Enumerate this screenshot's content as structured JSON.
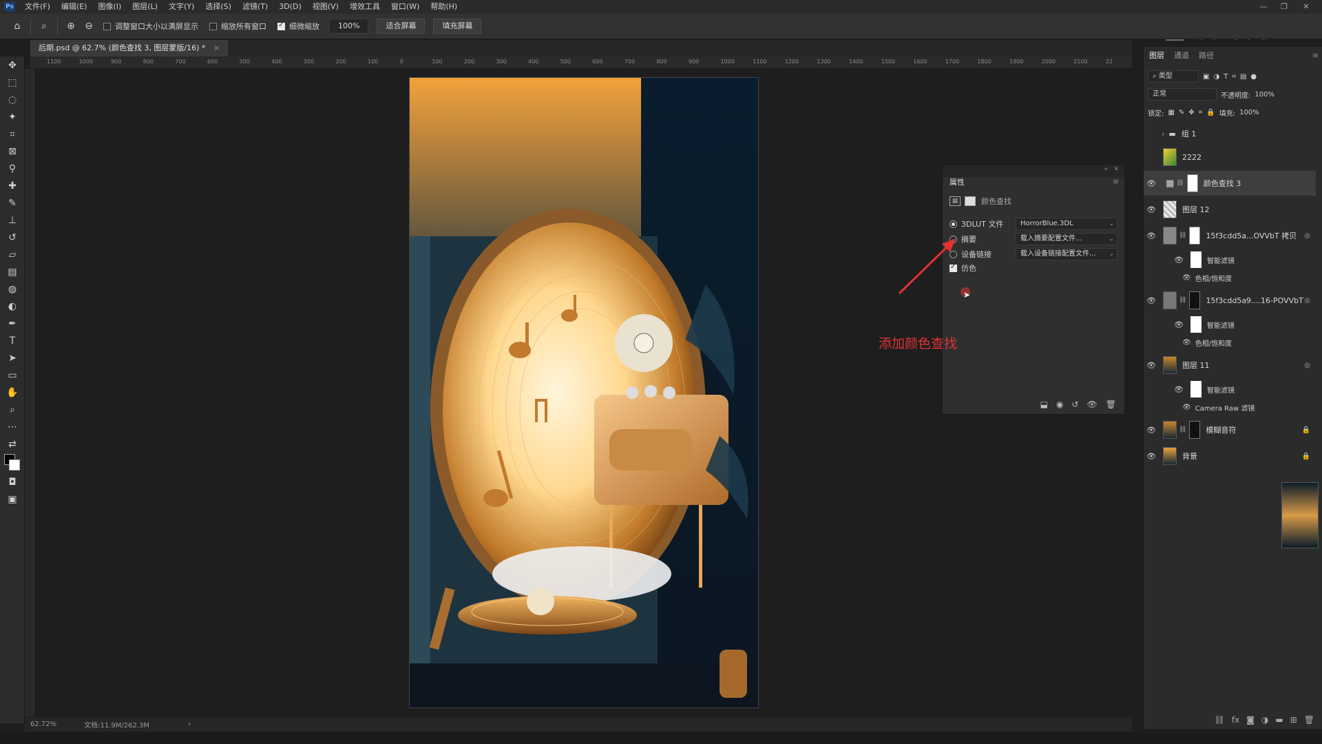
{
  "menubar": {
    "items": [
      "文件(F)",
      "编辑(E)",
      "图像(I)",
      "图层(L)",
      "文字(Y)",
      "选择(S)",
      "滤镜(T)",
      "3D(D)",
      "视图(V)",
      "增效工具",
      "窗口(W)",
      "帮助(H)"
    ],
    "logo": "Ps"
  },
  "options": {
    "resize_windows": "调整窗口大小以满屏显示",
    "zoom_all": "缩放所有窗口",
    "scrubby_zoom": "细微缩放",
    "zoom_value": "100%",
    "fit_screen": "适合屏幕",
    "fill_screen": "填充屏幕"
  },
  "document": {
    "tab_title": "后期.psd @ 62.7% (颜色查找 3, 图层蒙版/16) *"
  },
  "ruler": {
    "ticks": [
      "1100",
      "1000",
      "900",
      "800",
      "700",
      "600",
      "500",
      "400",
      "300",
      "200",
      "100",
      "0",
      "100",
      "200",
      "300",
      "400",
      "500",
      "600",
      "700",
      "800",
      "900",
      "1000",
      "1100",
      "1200",
      "1300",
      "1400",
      "1500",
      "1600",
      "1700",
      "1800",
      "1900",
      "2000",
      "2100",
      "22"
    ]
  },
  "status": {
    "zoom": "62.72%",
    "doc_size": "文档:11.9M/262.3M"
  },
  "properties": {
    "tab": "属性",
    "subheader": "颜色查找",
    "rows": [
      {
        "label": "3DLUT 文件",
        "value": "HorrorBlue.3DL",
        "selected": true
      },
      {
        "label": "摘要",
        "value": "载入摘要配置文件...",
        "selected": false
      },
      {
        "label": "设备链接",
        "value": "载入设备链接配置文件...",
        "selected": false
      }
    ],
    "dither": "仿色"
  },
  "annotation": {
    "text": "添加颜色查找",
    "color": "#e03232"
  },
  "layers": {
    "tabs": [
      "图层",
      "通道",
      "路径"
    ],
    "filter_kind": "类型",
    "blend_mode": "正常",
    "opacity_label": "不透明度:",
    "opacity_value": "100%",
    "lock_label": "锁定:",
    "fill_label": "填充:",
    "fill_value": "100%",
    "items": [
      {
        "name": "组 1",
        "kind": "group",
        "visible": false
      },
      {
        "name": "2222",
        "kind": "pixel",
        "visible": false
      },
      {
        "name": "颜色查找 3",
        "kind": "adjustment",
        "visible": true,
        "selected": true
      },
      {
        "name": "图层 12",
        "kind": "pixel",
        "visible": true
      },
      {
        "name": "15f3cdd5a...OVVbT 拷贝",
        "kind": "smart",
        "visible": true
      },
      {
        "name": "15f3cdd5a9....16-POVVbT",
        "kind": "smart",
        "visible": true
      },
      {
        "name": "图层 11",
        "kind": "smart",
        "visible": true
      },
      {
        "name": "模糊音符",
        "kind": "pixel",
        "visible": true
      },
      {
        "name": "背景",
        "kind": "background",
        "visible": true
      }
    ],
    "smart_filters_label": "智能滤镜",
    "hue_sat_label": "色相/饱和度",
    "camera_raw_label": "Camera Raw 滤镜"
  },
  "colors": {
    "accent": "#e03232",
    "panel_bg": "#2b2b2b",
    "canvas_bg": "#1e1e1e"
  }
}
